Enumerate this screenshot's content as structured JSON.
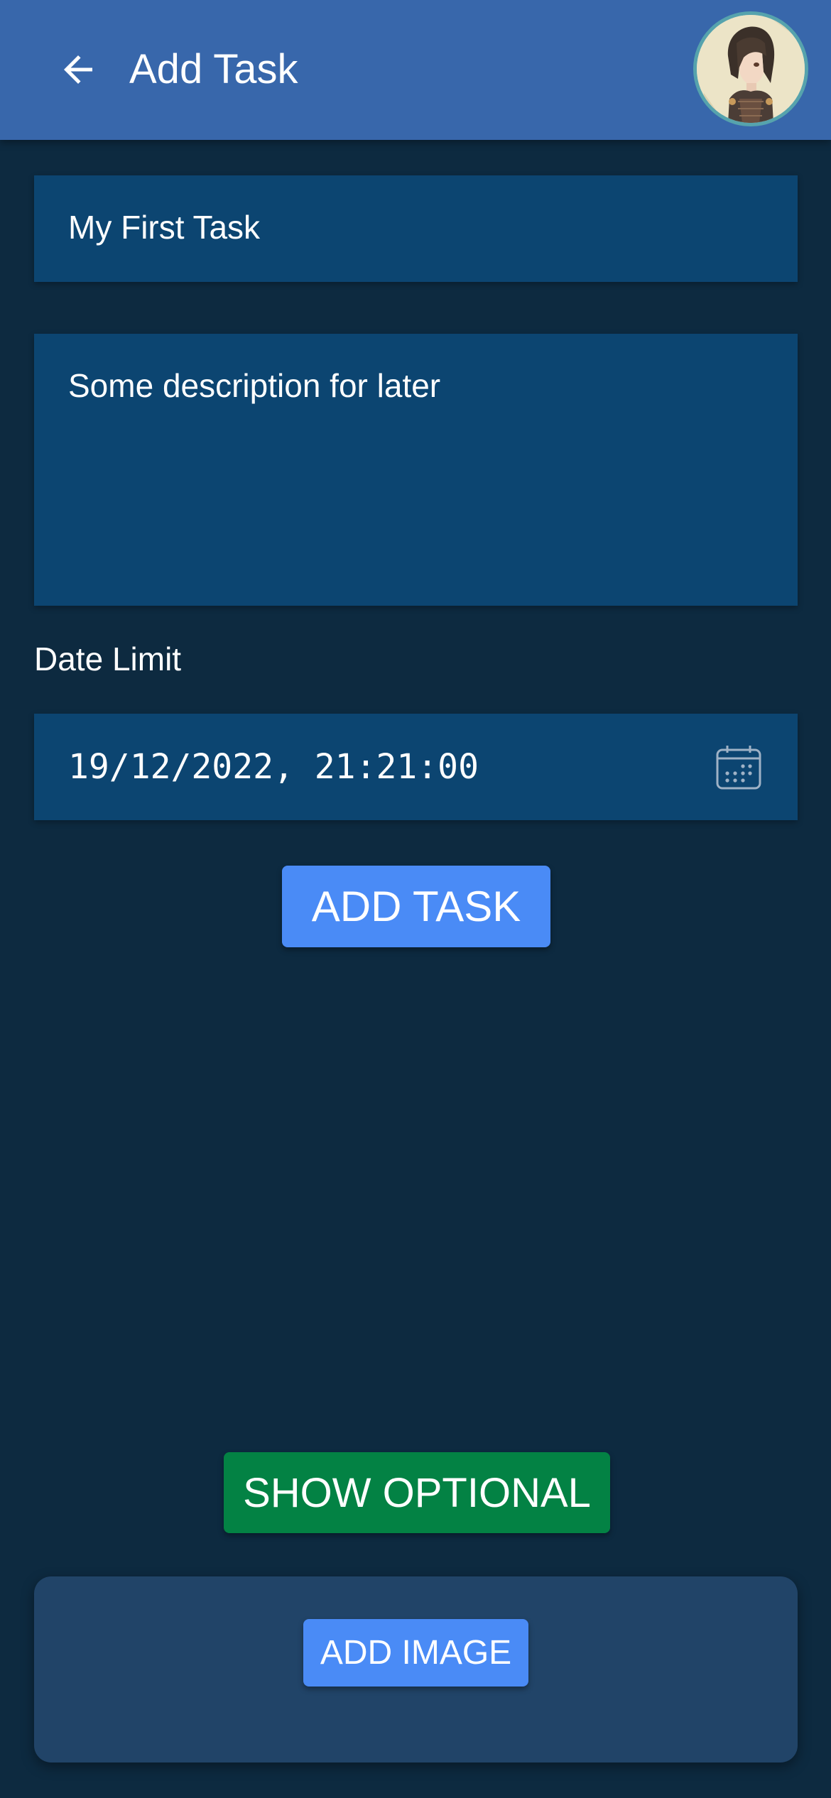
{
  "app_bar": {
    "title": "Add Task",
    "back_icon": "arrow-left-icon",
    "avatar": "user-avatar",
    "color": "#3867ab"
  },
  "form": {
    "title_value": "My First Task",
    "description_value": "Some description for later",
    "date_label": "Date Limit",
    "date_value": "19/12/2022, 21:21:00",
    "calendar_icon": "calendar-icon",
    "add_task_label": "ADD TASK"
  },
  "optional": {
    "show_optional_label": "SHOW OPTIONAL",
    "add_image_label": "ADD IMAGE"
  },
  "colors": {
    "background": "#0d2a40",
    "field": "#0c4571",
    "primary_button": "#4a8bf6",
    "success_button": "#038244",
    "panel": "#214468"
  }
}
